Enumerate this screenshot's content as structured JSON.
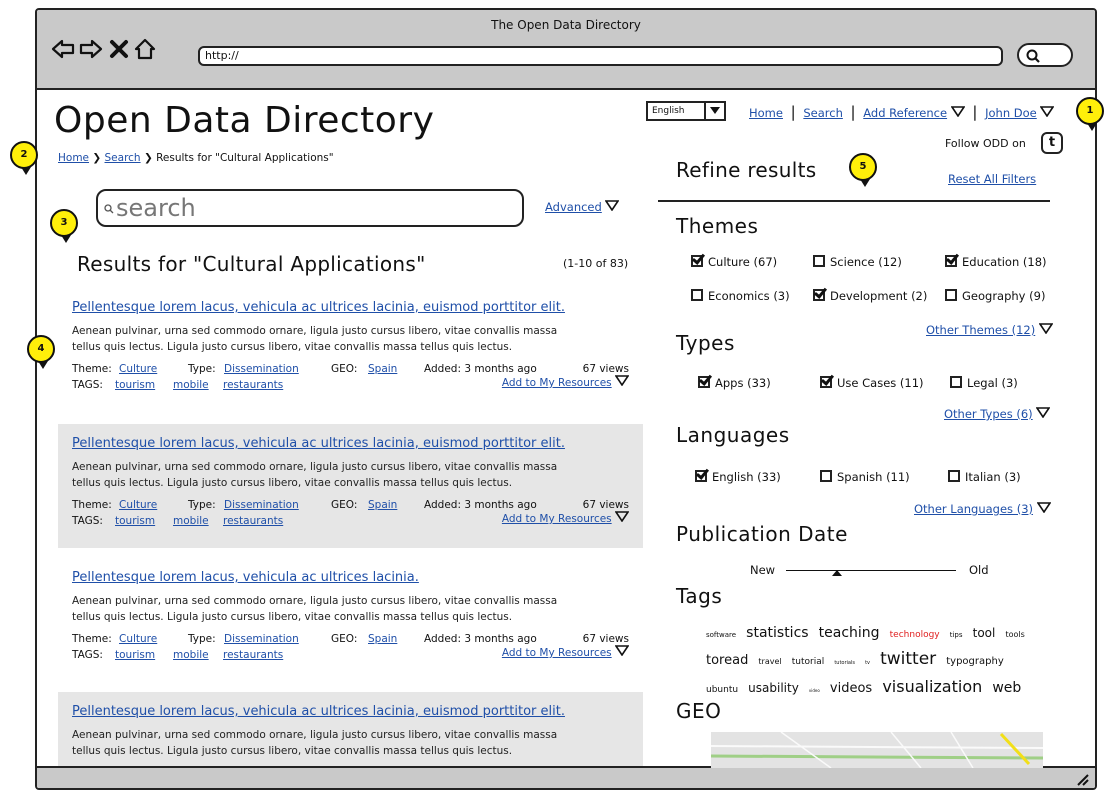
{
  "window": {
    "title": "The Open Data Directory",
    "url": "http://"
  },
  "header": {
    "title": "Open Data Directory",
    "breadcrumb": {
      "home": "Home",
      "search": "Search",
      "current": "Results for \"Cultural Applications\""
    },
    "language": "English",
    "nav": {
      "home": "Home",
      "search": "Search",
      "add_reference": "Add Reference",
      "user": "John Doe"
    },
    "follow": "Follow ODD on"
  },
  "search": {
    "placeholder": "search",
    "advanced": "Advanced"
  },
  "results": {
    "heading": "Results for \"Cultural Applications\"",
    "count": "(1-10 of 83)",
    "items": [
      {
        "title": "Pellentesque lorem lacus, vehicula ac ultrices lacinia, euismod porttitor elit.",
        "desc1": "Aenean pulvinar, urna sed commodo ornare, ligula justo cursus libero, vitae convallis massa",
        "desc2": "tellus quis lectus. Ligula justo cursus libero, vitae convallis massa tellus quis lectus.",
        "theme_label": "Theme:",
        "theme": "Culture",
        "type_label": "Type:",
        "type": "Dissemination",
        "geo_label": "GEO:",
        "geo": "Spain",
        "added": "Added: 3 months ago",
        "views": "67 views",
        "tags_label": "TAGS:",
        "tag1": "tourism",
        "tag2": "mobile",
        "tag3": "restaurants",
        "add": "Add to My Resources"
      },
      {
        "title": "Pellentesque lorem lacus, vehicula ac ultrices lacinia, euismod porttitor elit.",
        "desc1": "Aenean pulvinar, urna sed commodo ornare, ligula justo cursus libero, vitae convallis massa",
        "desc2": "tellus quis lectus. Ligula justo cursus libero, vitae convallis massa tellus quis lectus.",
        "theme_label": "Theme:",
        "theme": "Culture",
        "type_label": "Type:",
        "type": "Dissemination",
        "geo_label": "GEO:",
        "geo": "Spain",
        "added": "Added: 3 months ago",
        "views": "67 views",
        "tags_label": "TAGS:",
        "tag1": "tourism",
        "tag2": "mobile",
        "tag3": "restaurants",
        "add": "Add to My Resources"
      },
      {
        "title": "Pellentesque lorem lacus, vehicula ac ultrices lacinia.",
        "desc1": "Aenean pulvinar, urna sed commodo ornare, ligula justo cursus libero, vitae convallis massa",
        "desc2": "tellus quis lectus. Ligula justo cursus libero, vitae convallis massa tellus quis lectus.",
        "theme_label": "Theme:",
        "theme": "Culture",
        "type_label": "Type:",
        "type": "Dissemination",
        "geo_label": "GEO:",
        "geo": "Spain",
        "added": "Added: 3 months ago",
        "views": "67 views",
        "tags_label": "TAGS:",
        "tag1": "tourism",
        "tag2": "mobile",
        "tag3": "restaurants",
        "add": "Add to My Resources"
      },
      {
        "title": "Pellentesque lorem lacus, vehicula ac ultrices lacinia, euismod porttitor elit.",
        "desc1": "Aenean pulvinar, urna sed commodo ornare, ligula justo cursus libero, vitae convallis massa",
        "desc2": "tellus quis lectus. Ligula justo cursus libero, vitae convallis massa tellus quis lectus."
      }
    ]
  },
  "refine": {
    "title": "Refine results",
    "reset": "Reset All Filters",
    "themes": {
      "title": "Themes",
      "items": [
        {
          "label": "Culture (67)",
          "checked": true
        },
        {
          "label": "Science (12)",
          "checked": false
        },
        {
          "label": "Education (18)",
          "checked": true
        },
        {
          "label": "Economics (3)",
          "checked": false
        },
        {
          "label": "Development (2)",
          "checked": true
        },
        {
          "label": "Geography (9)",
          "checked": false
        }
      ],
      "other": "Other Themes (12)"
    },
    "types": {
      "title": "Types",
      "items": [
        {
          "label": "Apps (33)",
          "checked": true
        },
        {
          "label": "Use Cases (11)",
          "checked": true
        },
        {
          "label": "Legal (3)",
          "checked": false
        }
      ],
      "other": "Other Types (6)"
    },
    "languages": {
      "title": "Languages",
      "items": [
        {
          "label": "English (33)",
          "checked": true
        },
        {
          "label": "Spanish (11)",
          "checked": false
        },
        {
          "label": "Italian (3)",
          "checked": false
        }
      ],
      "other": "Other Languages (3)"
    },
    "pubdate": {
      "title": "Publication Date",
      "new": "New",
      "old": "Old",
      "position": 0.3
    },
    "tags": {
      "title": "Tags",
      "words": [
        "software",
        "statistics",
        "teaching",
        "technology",
        "tips",
        "tool",
        "tools",
        "toread",
        "travel",
        "tutorial",
        "tutorials",
        "tv",
        "twitter",
        "typography",
        "ubuntu",
        "usability",
        "video",
        "videos",
        "visualization",
        "web"
      ],
      "highlight_color": "#e02020"
    },
    "geo": {
      "title": "GEO"
    }
  },
  "callouts": [
    "1",
    "2",
    "3",
    "4",
    "5"
  ]
}
